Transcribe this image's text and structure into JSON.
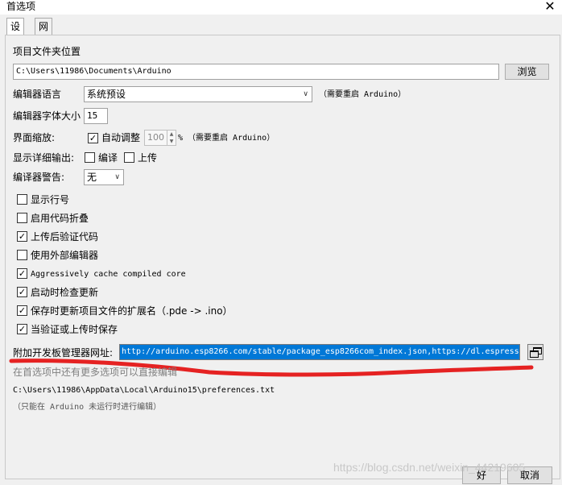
{
  "window": {
    "title": "首选项",
    "close_glyph": "✕"
  },
  "tabs": [
    {
      "label": "设置",
      "active": true
    },
    {
      "label": "网络",
      "active": false
    }
  ],
  "settings": {
    "sketchbook_label": "项目文件夹位置",
    "sketchbook_path": "C:\\Users\\11986\\Documents\\Arduino",
    "browse_label": "浏览",
    "editor_language_label": "编辑器语言",
    "editor_language_value": "系统预设",
    "restart_note": "（需要重启 Arduino）",
    "font_size_label": "编辑器字体大小",
    "font_size_value": "15",
    "scale_label": "界面缩放:",
    "auto_scale_label": "自动调整",
    "auto_scale_checked": true,
    "scale_value": "100",
    "scale_note": "% （需要重启 Arduino）",
    "verbose_label": "显示详细输出:",
    "verbose_compile_label": "编译",
    "verbose_upload_label": "上传",
    "warnings_label": "编译器警告:",
    "warnings_value": "无",
    "options": [
      {
        "label": "显示行号",
        "checked": false
      },
      {
        "label": "启用代码折叠",
        "checked": false
      },
      {
        "label": "上传后验证代码",
        "checked": true
      },
      {
        "label": "使用外部编辑器",
        "checked": false
      },
      {
        "label": "Aggressively cache compiled core",
        "checked": true
      },
      {
        "label": "启动时检查更新",
        "checked": true
      },
      {
        "label": "保存时更新项目文件的扩展名（.pde -> .ino）",
        "checked": true
      },
      {
        "label": "当验证或上传时保存",
        "checked": true
      }
    ],
    "board_urls_label": "附加开发板管理器网址:",
    "board_urls_value": "http://arduino.esp8266.com/stable/package_esp8266com_index.json,https://dl.espressi",
    "more_prefs_hint": "在首选项中还有更多选项可以直接编辑",
    "prefs_path": "C:\\Users\\11986\\AppData\\Local\\Arduino15\\preferences.txt",
    "edit_note": "（只能在 Arduino 未运行时进行编辑）"
  },
  "buttons": {
    "ok_label": "好",
    "cancel_label": "取消"
  },
  "annotation": {
    "color": "#e52222"
  },
  "watermark": "https://blog.csdn.net/weixin_44219605",
  "colors": {
    "selection": "#0078d7",
    "panel": "#f0f0f0"
  }
}
